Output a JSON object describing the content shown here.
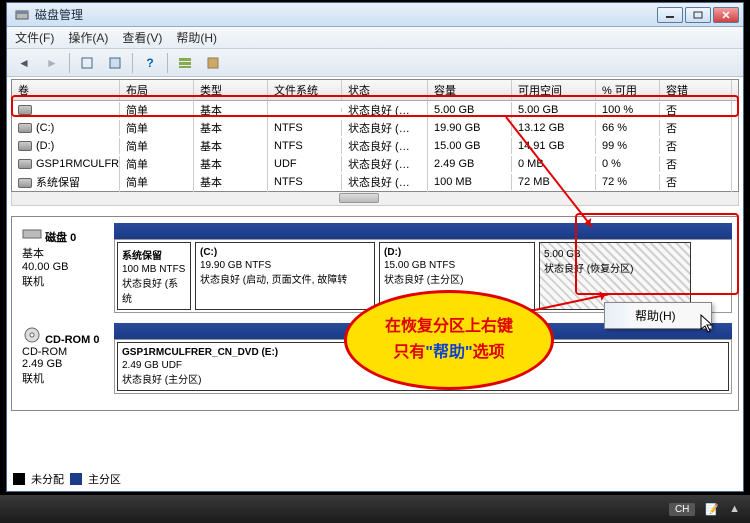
{
  "window": {
    "title": "磁盘管理"
  },
  "menu": {
    "file": "文件(F)",
    "action": "操作(A)",
    "view": "查看(V)",
    "help": "帮助(H)"
  },
  "columns": {
    "vol": "卷",
    "layout": "布局",
    "type": "类型",
    "fs": "文件系统",
    "status": "状态",
    "capacity": "容量",
    "free": "可用空间",
    "pct": "% 可用",
    "fault": "容错"
  },
  "volumes": [
    {
      "name": "",
      "layout": "简单",
      "type": "基本",
      "fs": "",
      "status": "状态良好 (…",
      "capacity": "5.00 GB",
      "free": "5.00 GB",
      "pct": "100 %",
      "fault": "否"
    },
    {
      "name": "(C:)",
      "layout": "简单",
      "type": "基本",
      "fs": "NTFS",
      "status": "状态良好 (…",
      "capacity": "19.90 GB",
      "free": "13.12 GB",
      "pct": "66 %",
      "fault": "否"
    },
    {
      "name": "(D:)",
      "layout": "简单",
      "type": "基本",
      "fs": "NTFS",
      "status": "状态良好 (…",
      "capacity": "15.00 GB",
      "free": "14.91 GB",
      "pct": "99 %",
      "fault": "否"
    },
    {
      "name": "GSP1RMCULFRE…",
      "layout": "简单",
      "type": "基本",
      "fs": "UDF",
      "status": "状态良好 (…",
      "capacity": "2.49 GB",
      "free": "0 MB",
      "pct": "0 %",
      "fault": "否"
    },
    {
      "name": "系统保留",
      "layout": "简单",
      "type": "基本",
      "fs": "NTFS",
      "status": "状态良好 (…",
      "capacity": "100 MB",
      "free": "72 MB",
      "pct": "72 %",
      "fault": "否"
    }
  ],
  "disk0": {
    "title": "磁盘 0",
    "type": "基本",
    "size": "40.00 GB",
    "state": "联机",
    "parts": [
      {
        "name": "系统保留",
        "info": "100 MB NTFS",
        "status": "状态良好 (系统"
      },
      {
        "name": "(C:)",
        "info": "19.90 GB NTFS",
        "status": "状态良好 (启动, 页面文件, 故障转"
      },
      {
        "name": "(D:)",
        "info": "15.00 GB NTFS",
        "status": "状态良好 (主分区)"
      },
      {
        "name": "",
        "info": "5.00 GB",
        "status": "状态良好 (恢复分区)"
      }
    ]
  },
  "cdrom": {
    "title": "CD-ROM 0",
    "type": "CD-ROM",
    "size": "2.49 GB",
    "state": "联机",
    "part": {
      "name": "GSP1RMCULFRER_CN_DVD  (E:)",
      "info": "2.49 GB UDF",
      "status": "状态良好 (主分区)"
    }
  },
  "legend": {
    "unalloc": "未分配",
    "primary": "主分区"
  },
  "context_menu": {
    "help": "帮助(H)"
  },
  "annotation": {
    "line1": "在恢复分区上右键",
    "line2_a": "只有",
    "line2_b": "\"帮助\"",
    "line2_c": "选项"
  },
  "taskbar": {
    "lang": "CH"
  }
}
